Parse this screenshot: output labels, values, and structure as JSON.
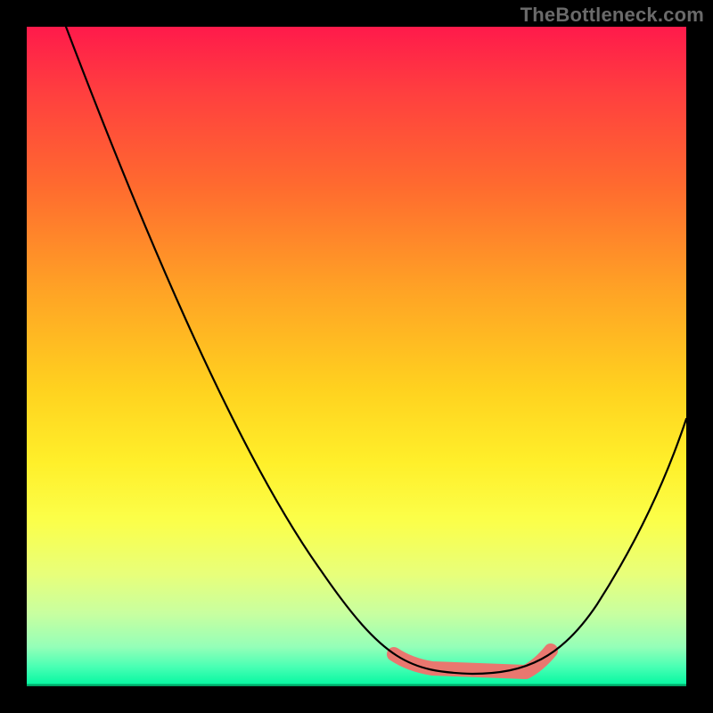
{
  "watermark": "TheBottleneck.com",
  "colors": {
    "curve": "#000000",
    "accent": "#e9776f",
    "frame": "#000000"
  },
  "chart_data": {
    "type": "line",
    "title": "",
    "xlabel": "",
    "ylabel": "",
    "xlim": [
      0,
      100
    ],
    "ylim": [
      0,
      100
    ],
    "grid": false,
    "legend": false,
    "series": [
      {
        "name": "bottleneck-curve",
        "x": [
          6,
          12,
          18,
          24,
          30,
          36,
          42,
          48,
          54,
          58,
          62,
          66,
          70,
          74,
          78,
          82,
          86,
          90,
          94,
          100
        ],
        "y": [
          100,
          89,
          78,
          67,
          56,
          45,
          35,
          26,
          18,
          12,
          7,
          4,
          2,
          2,
          4,
          8,
          15,
          26,
          40,
          60
        ]
      }
    ],
    "highlight_region": {
      "name": "sweet-spot",
      "x_range": [
        56,
        80
      ],
      "y": 3
    },
    "background_gradient_stops": [
      {
        "pos": 0.0,
        "color": "#ff1a4b"
      },
      {
        "pos": 0.5,
        "color": "#ffd21f"
      },
      {
        "pos": 0.85,
        "color": "#e8ff7a"
      },
      {
        "pos": 1.0,
        "color": "#00f7a0"
      }
    ]
  }
}
